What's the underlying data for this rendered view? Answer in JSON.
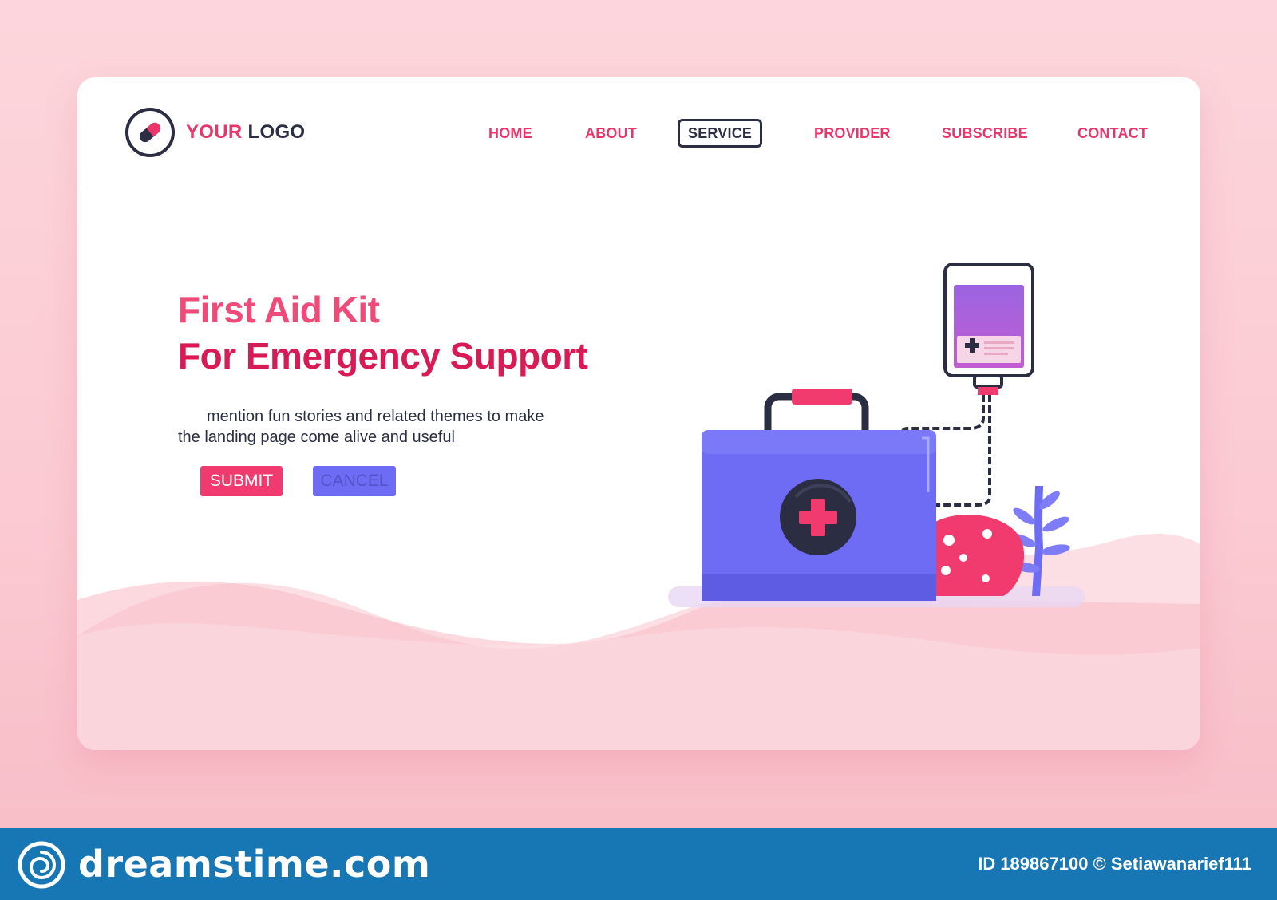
{
  "logo": {
    "word1": "YOUR",
    "word2": "LOGO",
    "icon": "capsule-icon"
  },
  "nav": {
    "items": [
      {
        "label": "HOME",
        "active": false
      },
      {
        "label": "ABOUT",
        "active": false
      },
      {
        "label": "SERVICE",
        "active": true
      },
      {
        "label": "PROVIDER",
        "active": false
      },
      {
        "label": "SUBSCRIBE",
        "active": false
      },
      {
        "label": "CONTACT",
        "active": false
      }
    ]
  },
  "hero": {
    "title_line1": "First Aid Kit",
    "title_line2": "For Emergency Support",
    "description_line1": "mention fun stories and related themes to make",
    "description_line2": "the landing page come alive and useful",
    "submit_label": "SUBMIT",
    "cancel_label": "CANCEL"
  },
  "illustration": {
    "items": [
      "first-aid-kit-icon",
      "iv-bag-icon",
      "medical-cross-icon",
      "plant-leaf-icon"
    ]
  },
  "watermark": {
    "brand": "dreamstime.com",
    "id_text": "ID 189867100 © Setiawanarief111",
    "icon": "dreamstime-swirl-icon"
  },
  "colors": {
    "accent": "#e8366a",
    "dark": "#2b2d42",
    "kit": "#6e6cf4",
    "footer": "#1777b4",
    "background": "#fbc9d1"
  }
}
